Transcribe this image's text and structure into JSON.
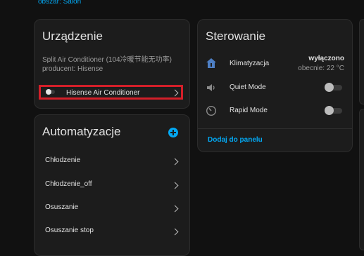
{
  "area": {
    "link_text": "obszar: Salon"
  },
  "device_card": {
    "title": "Urządzenie",
    "model": "Split Air Conditioner (104冷暖节能无功率)",
    "manufacturer": "producent: Hisense",
    "device_link": {
      "label": "Hisense Air Conditioner",
      "icon": "toggle-icon"
    }
  },
  "control_card": {
    "title": "Sterowanie",
    "entities": [
      {
        "label": "Klimatyzacja",
        "icon": "home-thermostat-icon",
        "state": "wyłączono",
        "sub_state": "obecnie: 22 °C"
      },
      {
        "label": "Quiet Mode",
        "icon": "volume-icon",
        "switch_on": false
      },
      {
        "label": "Rapid Mode",
        "icon": "speedometer-icon",
        "switch_on": false
      }
    ],
    "footer_action": "Dodaj do panelu"
  },
  "automation_card": {
    "title": "Automatyzacje",
    "add_icon": "plus-icon",
    "items": [
      {
        "label": "Chłodzenie"
      },
      {
        "label": "Chłodzenie_off"
      },
      {
        "label": "Osuszanie"
      },
      {
        "label": "Osuszanie stop"
      }
    ]
  },
  "colors": {
    "accent": "#03a9f4",
    "highlight": "#d41f29",
    "card_bg": "#1c1c1c",
    "page_bg": "#111111"
  }
}
